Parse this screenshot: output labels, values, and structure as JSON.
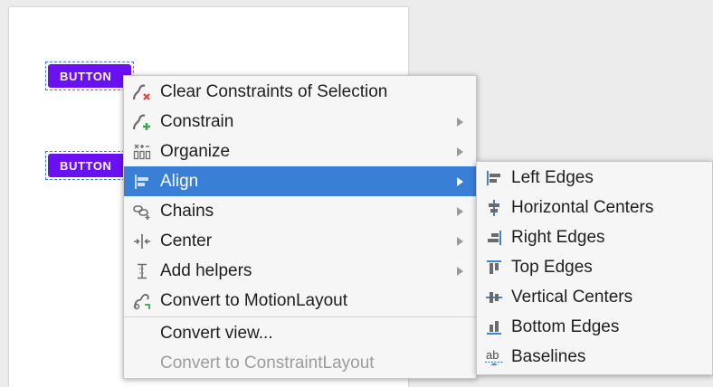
{
  "canvas": {
    "button_1_label": "BUTTON",
    "button_2_label": "BUTTON"
  },
  "context_menu": {
    "items": [
      {
        "label": "Clear Constraints of Selection",
        "icon": "clear-constraints-icon",
        "submenu": false
      },
      {
        "label": "Constrain",
        "icon": "constrain-icon",
        "submenu": true
      },
      {
        "label": "Organize",
        "icon": "organize-icon",
        "submenu": true
      },
      {
        "label": "Align",
        "icon": "align-icon",
        "submenu": true,
        "selected": true
      },
      {
        "label": "Chains",
        "icon": "chains-icon",
        "submenu": true
      },
      {
        "label": "Center",
        "icon": "center-icon",
        "submenu": true
      },
      {
        "label": "Add helpers",
        "icon": "helpers-icon",
        "submenu": true
      },
      {
        "label": "Convert to MotionLayout",
        "icon": "motion-layout-icon",
        "submenu": false
      },
      {
        "label": "Convert view...",
        "submenu": false
      },
      {
        "label": "Convert to ConstraintLayout",
        "submenu": false,
        "disabled": true
      }
    ]
  },
  "align_submenu": {
    "items": [
      {
        "label": "Left Edges",
        "icon": "align-left-edges-icon"
      },
      {
        "label": "Horizontal Centers",
        "icon": "align-horizontal-centers-icon"
      },
      {
        "label": "Right Edges",
        "icon": "align-right-edges-icon"
      },
      {
        "label": "Top Edges",
        "icon": "align-top-edges-icon"
      },
      {
        "label": "Vertical Centers",
        "icon": "align-vertical-centers-icon"
      },
      {
        "label": "Bottom Edges",
        "icon": "align-bottom-edges-icon"
      },
      {
        "label": "Baselines",
        "icon": "align-baselines-icon",
        "icon_text": "ab"
      }
    ]
  },
  "colors": {
    "accent_selection": "#3a7fd6",
    "button_purple": "#6a11f2",
    "icon_blue": "#3f82d0",
    "icon_gray": "#6b6b6b"
  }
}
